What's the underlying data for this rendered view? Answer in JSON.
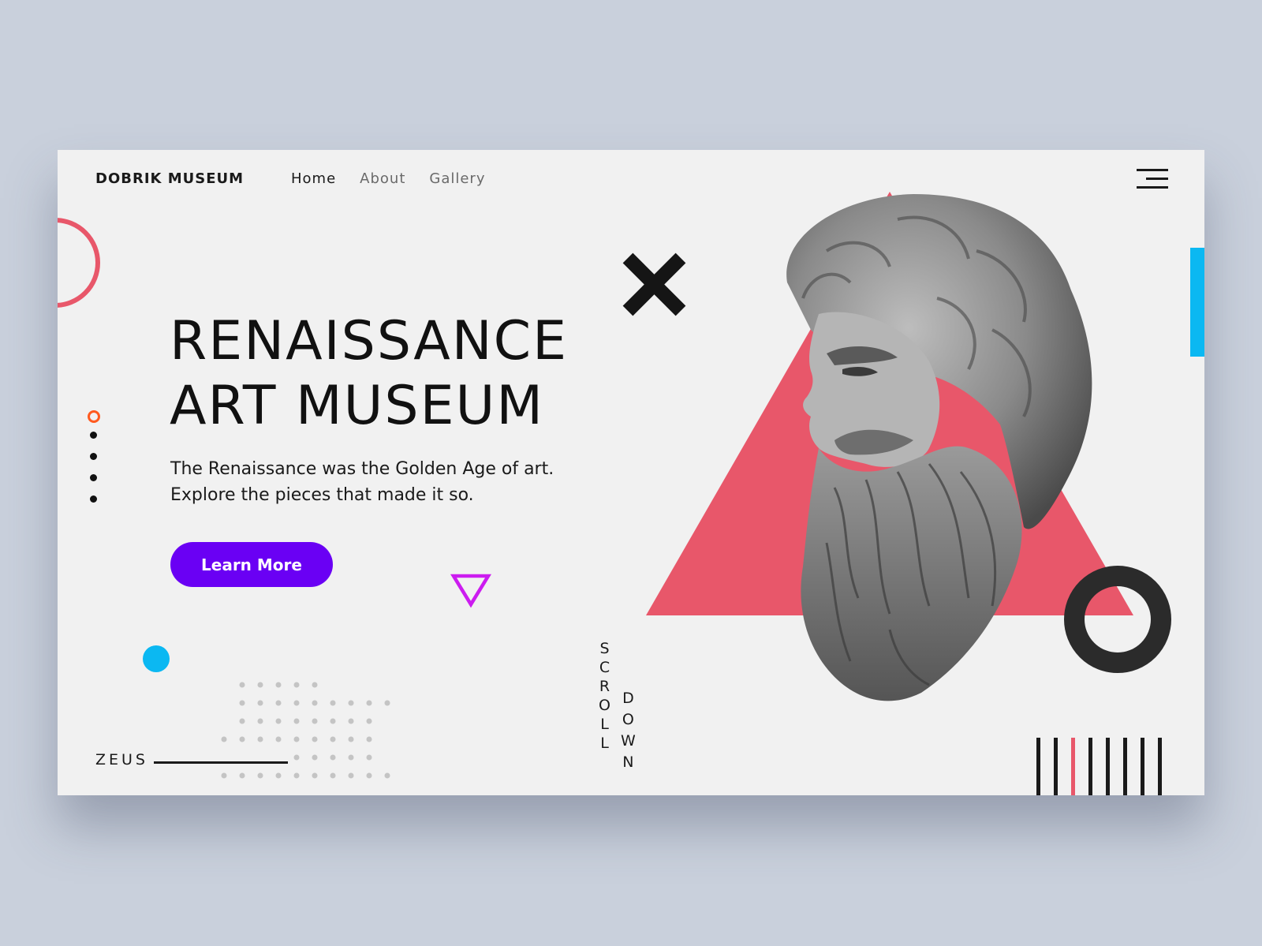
{
  "header": {
    "brand": "DOBRIK MUSEUM",
    "nav": [
      {
        "label": "Home",
        "active": true
      },
      {
        "label": "About",
        "active": false
      },
      {
        "label": "Gallery",
        "active": false
      }
    ]
  },
  "hero": {
    "title_line1": "RENAISSANCE",
    "title_line2": "ART MUSEUM",
    "description": "The Renaissance was the Golden Age of art. Explore the pieces that made it so.",
    "cta_label": "Learn More"
  },
  "slider": {
    "total": 5,
    "active_index": 0
  },
  "footer": {
    "figure_name": "ZEUS"
  },
  "scroll_hint": {
    "word1_letters": [
      "S",
      "C",
      "R",
      "O",
      "L",
      "L"
    ],
    "word2_letters": [
      "D",
      "O",
      "W",
      "N"
    ]
  },
  "icons": {
    "menu": "hamburger-menu-icon",
    "close": "x-cross-icon",
    "triangle": "down-triangle-icon",
    "ring": "ring-icon"
  },
  "colors": {
    "background": "#c9d0dc",
    "card": "#f1f1f1",
    "accent_purple": "#6a00f4",
    "accent_red": "#e8576a",
    "accent_blue": "#0bb8f2",
    "accent_orange": "#ff5a1f",
    "accent_magenta": "#cc1cf0",
    "dark": "#1a1a1a"
  }
}
